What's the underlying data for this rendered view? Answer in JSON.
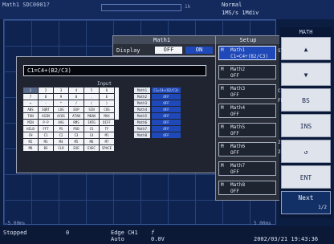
{
  "topbar": {
    "left_status": "Math1  SDC0001?",
    "center_status": "Normal",
    "right_status": "1MS/s  1Mdiv",
    "small_tag": "1k"
  },
  "math_header": {
    "title": "Math1",
    "display_label": "Display",
    "off_label": "OFF",
    "on_label": "ON"
  },
  "dialog": {
    "expression": "C1=C4+(B2/C3)",
    "keypad_title": "Input",
    "keys": [
      "1",
      "2",
      "3",
      "4",
      "5",
      "6",
      "7",
      "8",
      "9",
      "0",
      ".",
      "E",
      "+",
      "-",
      "*",
      "/",
      "(",
      ")",
      "ABS",
      "SQRT",
      "LOG",
      "EXP",
      "SIN",
      "COS",
      "TAN",
      "ASIN",
      "ACOS",
      "ATAN",
      "MEAN",
      "MAX",
      "MIN",
      "P-P",
      "AVG",
      "RMS",
      "INTG",
      "DIFF",
      "HILB",
      "FFT",
      "PS",
      "PSD",
      "CS",
      "TF",
      "CH",
      "C1",
      "C2",
      "C3",
      "C4",
      "M1",
      "M2",
      "M3",
      "M4",
      "M5",
      "M6",
      "M7",
      "M8",
      "BS",
      "CLR",
      "EXE",
      "EXEC",
      "SPACE"
    ],
    "selected_key": "1",
    "math_table": [
      {
        "name": "Math1",
        "value": "C1=C4+(B2/C3)"
      },
      {
        "name": "Math2",
        "value": "OFF"
      },
      {
        "name": "Math3",
        "value": "OFF"
      },
      {
        "name": "Math4",
        "value": "OFF"
      },
      {
        "name": "Math5",
        "value": "OFF"
      },
      {
        "name": "Math6",
        "value": "OFF"
      },
      {
        "name": "Math7",
        "value": "OFF"
      },
      {
        "name": "Math8",
        "value": "OFF"
      }
    ]
  },
  "setup": {
    "title": "Setup",
    "items": [
      {
        "mark": "M",
        "name": "Math1",
        "value": "C1=C4+(B2/C3)"
      },
      {
        "mark": "M",
        "name": "Math2",
        "value": "OFF"
      },
      {
        "mark": "M",
        "name": "Math3",
        "value": "OFF"
      },
      {
        "mark": "M",
        "name": "Math4",
        "value": "OFF"
      },
      {
        "mark": "M",
        "name": "Math5",
        "value": "OFF"
      },
      {
        "mark": "M",
        "name": "Math6",
        "value": "OFF"
      },
      {
        "mark": "M",
        "name": "Math7",
        "value": "OFF"
      },
      {
        "mark": "M",
        "name": "Math8",
        "value": "OFF"
      }
    ]
  },
  "softkeys": {
    "title": "MATH",
    "keys": [
      "▲",
      "▼",
      "BS",
      "INS",
      "↺",
      "ENT",
      "Next"
    ],
    "next_sub": "1/2",
    "side_labels": [
      "ST",
      "FF",
      "C7",
      "2:",
      "2:"
    ]
  },
  "bottombar": {
    "state": "Stopped",
    "count": "0",
    "trigger": "Edge CH1",
    "trigger_mode": "Auto",
    "trigger_sym": "f",
    "trigger_level": "0.0V",
    "datetime": "2002/03/21 19:43:36",
    "left_time": "-5.00ms",
    "right_time": "5.00ms"
  }
}
